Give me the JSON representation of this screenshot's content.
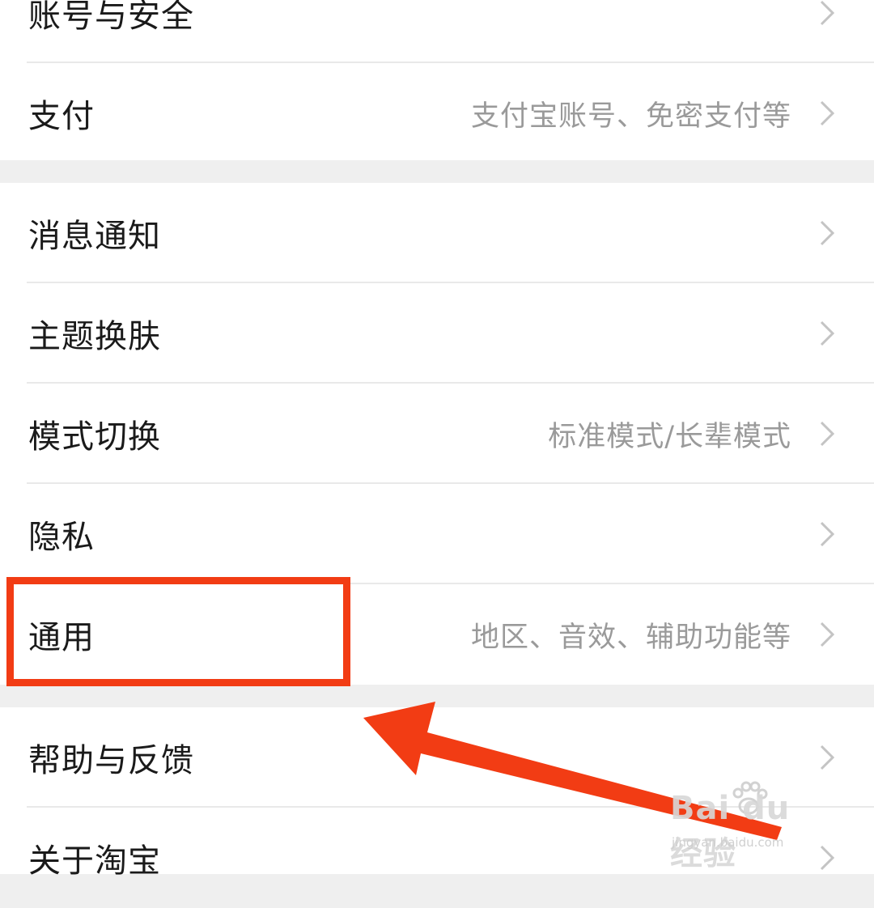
{
  "settings": {
    "group1": [
      {
        "label": "账号与安全",
        "sub": ""
      },
      {
        "label": "支付",
        "sub": "支付宝账号、免密支付等"
      }
    ],
    "group2": [
      {
        "label": "消息通知",
        "sub": ""
      },
      {
        "label": "主题换肤",
        "sub": ""
      },
      {
        "label": "模式切换",
        "sub": "标准模式/长辈模式"
      },
      {
        "label": "隐私",
        "sub": ""
      },
      {
        "label": "通用",
        "sub": "地区、音效、辅助功能等"
      }
    ],
    "group3": [
      {
        "label": "帮助与反馈",
        "sub": ""
      },
      {
        "label": "关于淘宝",
        "sub": ""
      }
    ]
  },
  "annotation": {
    "color": "#f23c14"
  },
  "watermark": {
    "logo": "Bai du 经验",
    "url": "jingyan.baidu.com"
  },
  "icons": {
    "chevron": "chevron-right-icon"
  }
}
